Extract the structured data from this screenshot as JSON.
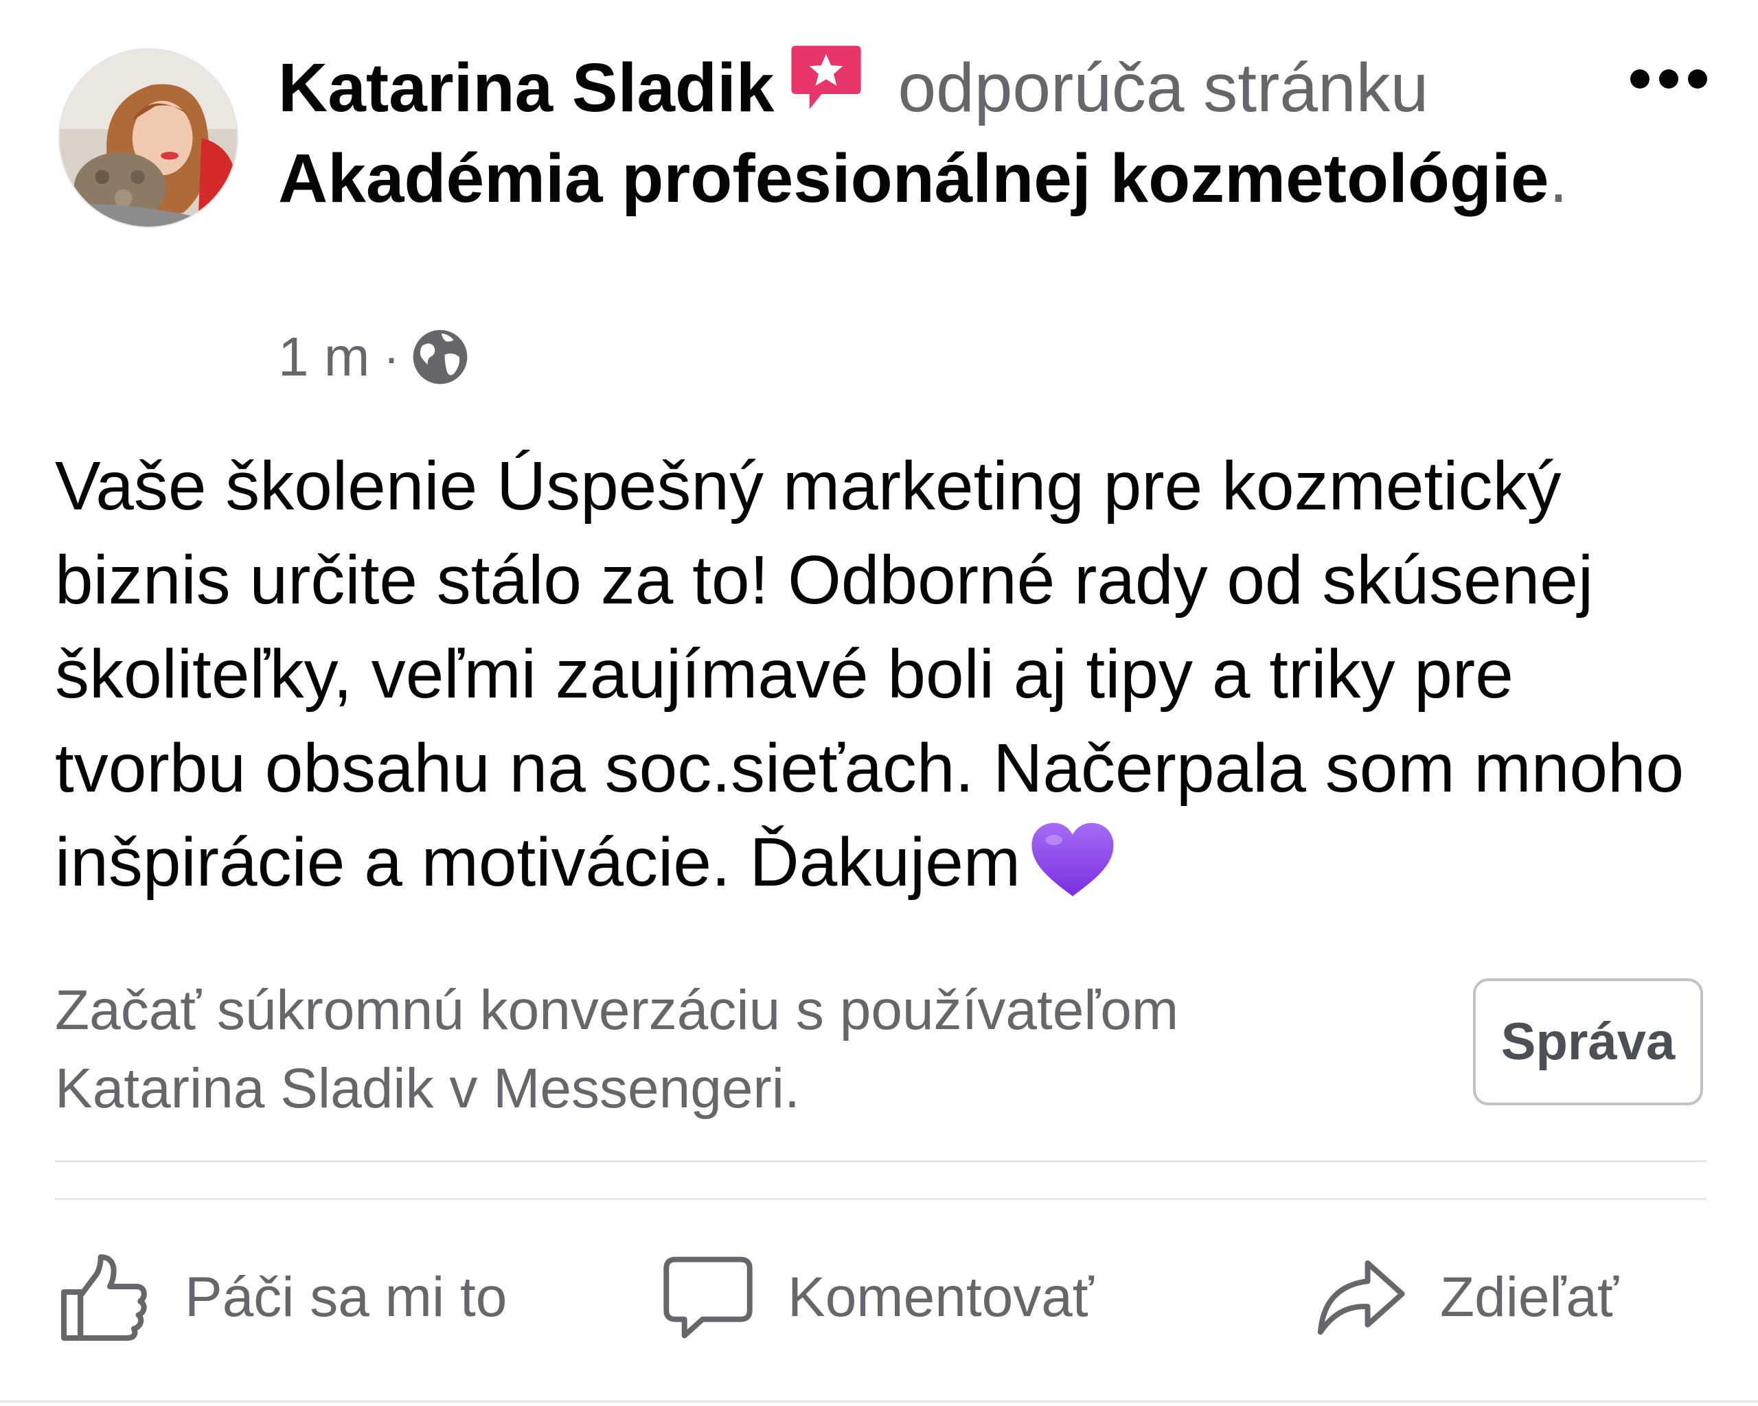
{
  "post": {
    "author": "Katarina Sladik",
    "action_text": "odporúča stránku",
    "page_name": "Akadémia profesionálnej kozmetológie",
    "page_name_suffix": ".",
    "time": "1 m",
    "meta_separator": "·",
    "privacy_icon": "globe-icon",
    "badge_icon": "recommendation-star-icon",
    "body": "Vaše školenie Úspešný marketing pre kozmetický biznis určite stálo za to! Odborné rady od skúsenej školiteľky, veľmi zaujímavé boli aj tipy a triky pre tvorbu obsahu na soc.sieťach. Načerpala som mnoho inšpirácie a motivácie. Ďakujem",
    "body_emoji": "purple-heart-icon"
  },
  "messenger": {
    "prompt": "Začať súkromnú konverzáciu s používateľom Katarina Sladik v Messengeri.",
    "button_label": "Správa"
  },
  "actions": {
    "like_label": "Páči sa mi to",
    "comment_label": "Komentovať",
    "share_label": "Zdieľať"
  },
  "colors": {
    "text_primary": "#050505",
    "text_secondary": "#65676b",
    "badge": "#e8366a",
    "heart": "#8e44ec",
    "divider": "#e4e6eb"
  }
}
